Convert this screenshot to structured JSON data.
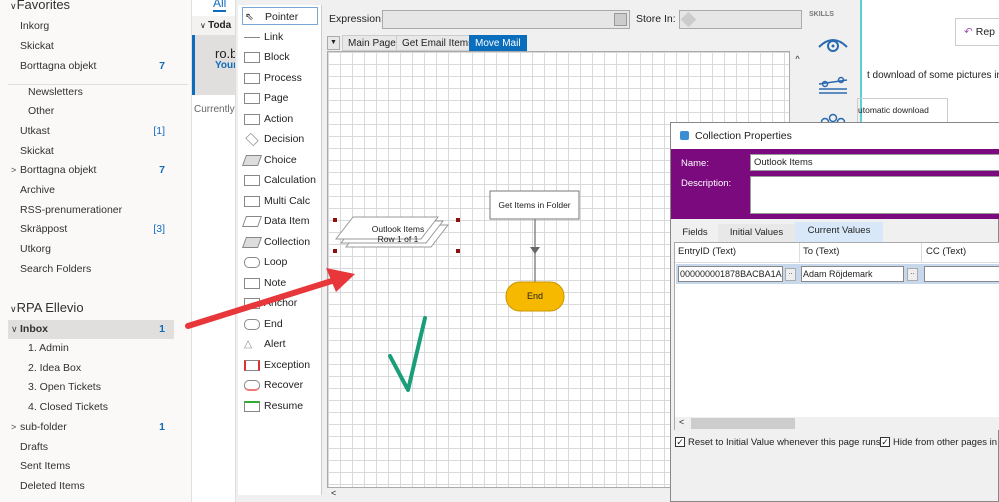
{
  "outlook": {
    "favorites_label": "Favorites",
    "favorites": [
      {
        "label": "Inkorg"
      },
      {
        "label": "Skickat"
      },
      {
        "label": "Borttagna objekt",
        "count": "7"
      }
    ],
    "folders": [
      {
        "label": "Newsletters"
      },
      {
        "label": "Other"
      },
      {
        "label": "Utkast",
        "count": "[1]"
      },
      {
        "label": "Skickat"
      },
      {
        "label": "Borttagna objekt",
        "count": "7"
      },
      {
        "label": "Archive"
      },
      {
        "label": "RSS-prenumerationer"
      },
      {
        "label": "Skräppost",
        "count": "[3]"
      },
      {
        "label": "Utkorg"
      },
      {
        "label": "Search Folders"
      }
    ],
    "account_label": "RPA Ellevio",
    "account_folders": [
      {
        "label": "Inbox",
        "count": "1"
      },
      {
        "label": "1. Admin"
      },
      {
        "label": "2. Idea Box"
      },
      {
        "label": "3. Open Tickets"
      },
      {
        "label": "4. Closed Tickets"
      },
      {
        "label": "sub-folder",
        "count": "1"
      },
      {
        "label": "Drafts"
      },
      {
        "label": "Sent Items"
      },
      {
        "label": "Deleted Items"
      }
    ],
    "list_filter": "All",
    "group_header": "Toda",
    "mail_sender": "ro.b",
    "mail_subject": "Your",
    "status_text": "Currently",
    "reply_label": "Rep",
    "info_text": "t download of some pictures in t",
    "download_option": "utomatic download"
  },
  "blueprism": {
    "tools": [
      "Pointer",
      "Link",
      "Block",
      "Process",
      "Page",
      "Action",
      "Decision",
      "Choice",
      "Calculation",
      "Multi Calc",
      "Data Item",
      "Collection",
      "Loop",
      "Note",
      "Anchor",
      "End",
      "Alert",
      "Exception",
      "Recover",
      "Resume"
    ],
    "expression_label": "Expression:",
    "expression_value": "",
    "store_in_label": "Store In:",
    "store_in_value": "",
    "skills_label": "SKILLS",
    "page_tabs": [
      "Main Page",
      "Get Email Items",
      "Move Mail"
    ],
    "active_tab": "Move Mail",
    "diagram": {
      "collection_name": "Outlook Items",
      "collection_rows": "Row 1 of 1",
      "action_label": "Get Items in Folder",
      "end_label": "End"
    }
  },
  "dialog": {
    "title": "Collection Properties",
    "name_label": "Name:",
    "name_value": "Outlook Items",
    "description_label": "Description:",
    "description_value": "",
    "tabs": [
      "Fields",
      "Initial Values",
      "Current Values"
    ],
    "active_tab": "Current Values",
    "columns": [
      "EntryID  (Text)",
      "To  (Text)",
      "CC  (Text)"
    ],
    "row": [
      "000000001878BACBA1A",
      "Adam Röjdemark",
      ""
    ],
    "reset_label": "Reset to Initial Value whenever this page runs",
    "hide_label": "Hide from other pages in the"
  },
  "colors": {
    "accent": "#0a6ebd",
    "dialog_header": "#7b0a7e",
    "end_fill": "#f7b900",
    "annotation_arrow": "#e8373a",
    "annotation_check": "#1a9e7a"
  }
}
